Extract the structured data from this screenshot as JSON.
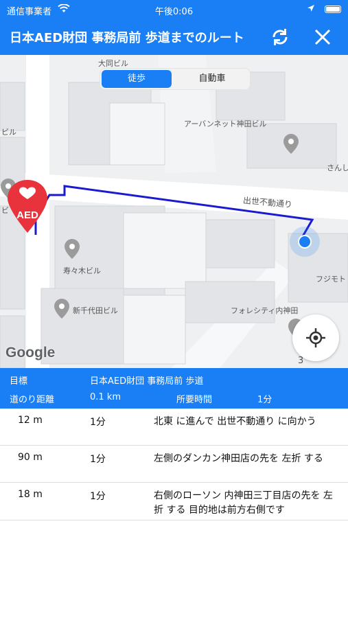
{
  "status": {
    "carrier": "通信事業者",
    "time": "午後0:06"
  },
  "nav": {
    "title": "日本AED財団 事務局前 歩道までのルート"
  },
  "map": {
    "modes": [
      "徒歩",
      "自動車"
    ],
    "labels": [
      "大同ビル",
      "アーバンネット神田ビル",
      "さんし",
      "ビル",
      "出世不動通り",
      "ビ",
      "寿々木ビル",
      "フジモト",
      "新千代田ビル",
      "フォレシティ内神田",
      "3"
    ],
    "aed_label": "AED",
    "google_logo": "Google"
  },
  "info": {
    "target_label": "目標",
    "target_value": "日本AED財団 事務局前 歩道",
    "distance_label": "道のり距離",
    "distance_value": "0.1 km",
    "time_label": "所要時間",
    "time_value": "1分"
  },
  "steps": [
    {
      "distance": "12 m",
      "time": "1分",
      "instruction": " 北東 に進んで 出世不動通り に向かう"
    },
    {
      "distance": "90 m",
      "time": "1分",
      "instruction": "左側のダンカン神田店の先を 左折 する"
    },
    {
      "distance": "18 m",
      "time": "1分",
      "instruction": "右側のローソン 内神田三丁目店の先を 左折 する 目的地は前方右側です"
    }
  ],
  "colors": {
    "accent": "#1a7ef5",
    "route": "#1a1ad0",
    "aed": "#e8323c"
  },
  "icons": {
    "wifi": "wifi-icon",
    "location_arrow": "location-arrow-icon",
    "battery": "battery-icon",
    "refresh": "refresh-icon",
    "close": "close-icon",
    "locate": "crosshair-icon",
    "pin": "map-pin-icon"
  }
}
